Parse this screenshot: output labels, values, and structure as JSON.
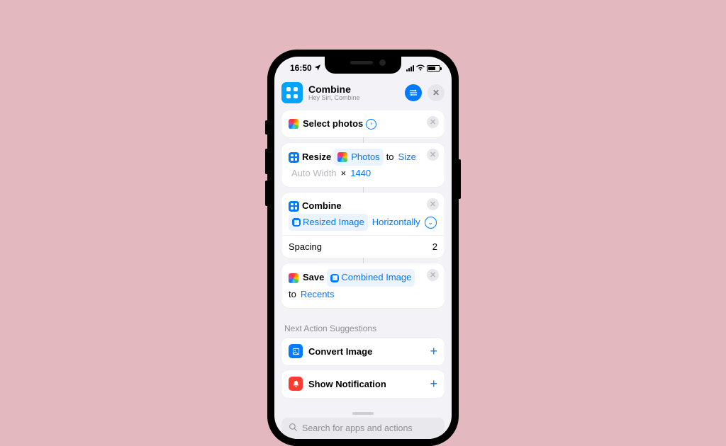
{
  "status": {
    "time": "16:50"
  },
  "header": {
    "title": "Combine",
    "subtitle": "Hey Siri, Combine"
  },
  "actions": {
    "select_photos": {
      "label": "Select photos"
    },
    "resize": {
      "verb": "Resize",
      "input": "Photos",
      "to": "to",
      "target": "Size",
      "width": "Auto Width",
      "times": "×",
      "height": "1440"
    },
    "combine": {
      "verb": "Combine",
      "input": "Resized Image",
      "mode": "Horizontally",
      "spacing_label": "Spacing",
      "spacing_value": "2"
    },
    "save": {
      "verb": "Save",
      "input": "Combined Image",
      "to": "to",
      "dest": "Recents"
    }
  },
  "suggestions": {
    "title": "Next Action Suggestions",
    "items": [
      {
        "label": "Convert Image"
      },
      {
        "label": "Show Notification"
      }
    ]
  },
  "search": {
    "placeholder": "Search for apps and actions"
  }
}
